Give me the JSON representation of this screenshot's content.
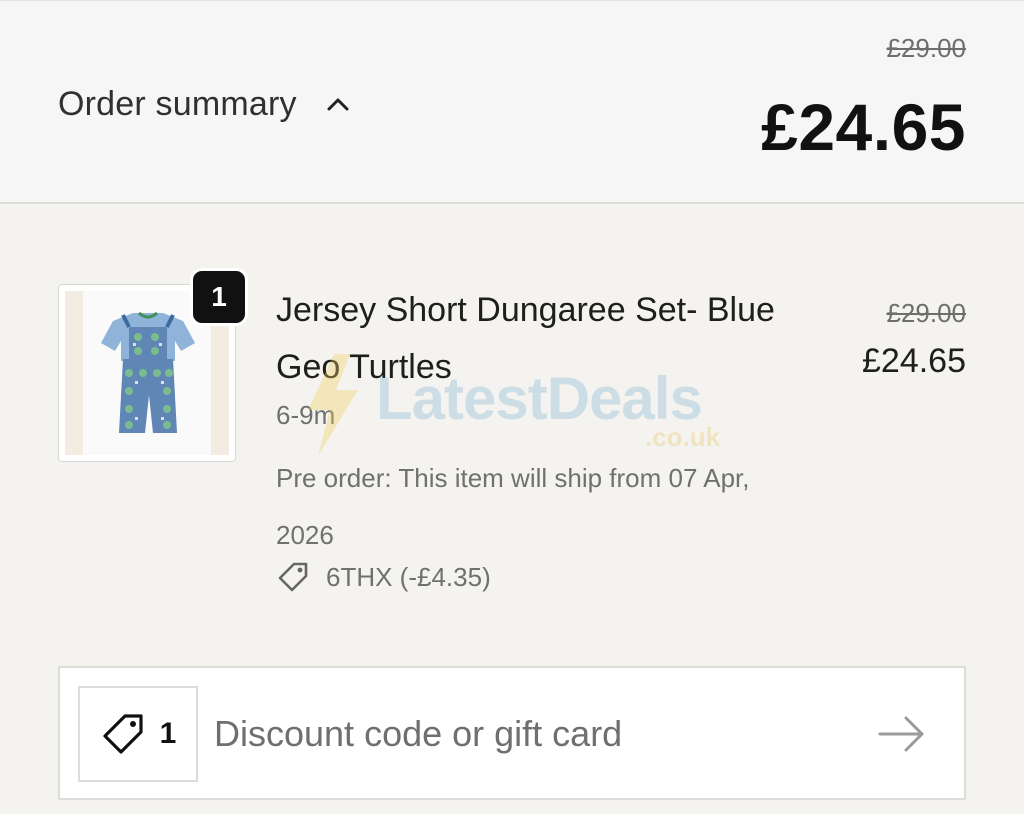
{
  "header": {
    "title": "Order summary",
    "toggle_icon": "chevron-up-icon",
    "original_total": "£29.00",
    "total": "£24.65"
  },
  "item": {
    "quantity": "1",
    "name": "Jersey Short Dungaree Set- Blue Geo Turtles",
    "variant": "6-9m",
    "note": "Pre order: This item will ship from 07 Apr, 2026",
    "discount_icon": "tag-icon",
    "discount_label": "6THX (-£4.35)",
    "original_price": "£29.00",
    "price": "£24.65",
    "image_icon": "product-image"
  },
  "discount_field": {
    "icon": "tag-icon",
    "applied_count": "1",
    "placeholder": "Discount code or gift card",
    "submit_icon": "arrow-right-icon"
  },
  "watermark": {
    "text": "LatestDeals",
    "sub": ".co.uk"
  },
  "colors": {
    "background": "#f4f3ef",
    "header_background": "#f6f6f6",
    "badge": "#111111",
    "muted_text": "#707070"
  }
}
